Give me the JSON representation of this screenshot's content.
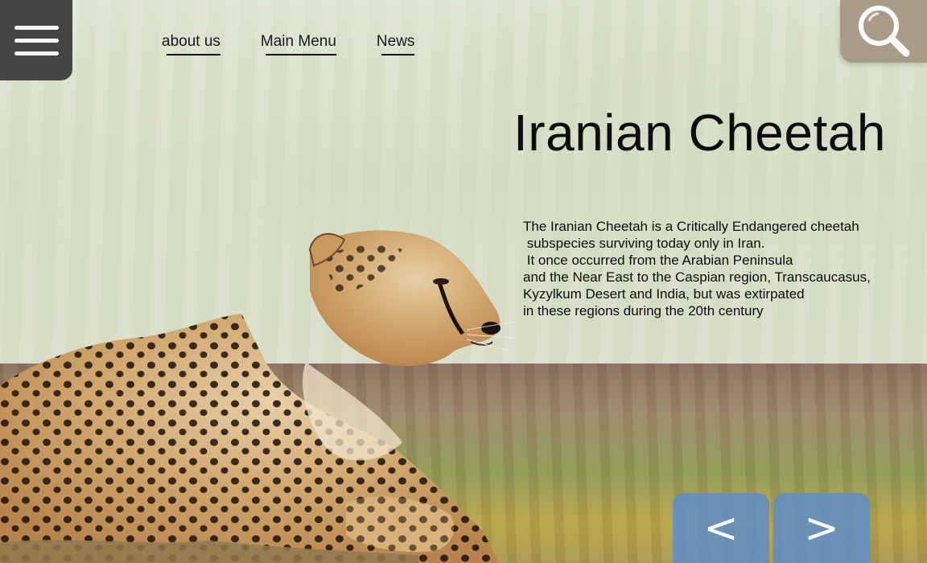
{
  "header": {
    "menu_icon": "hamburger-icon",
    "search_icon": "search-icon",
    "nav": [
      {
        "label": "about us"
      },
      {
        "label": "Main Menu"
      },
      {
        "label": "News"
      }
    ]
  },
  "hero": {
    "title": "Iranian Cheetah",
    "description_lines": [
      "The Iranian Cheetah is a Critically Endangered cheetah",
      " subspecies surviving today only in Iran.",
      " It once occurred from the Arabian Peninsula",
      "and the Near East to the Caspian region, Transcaucasus,",
      "Kyzylkum Desert and India, but was extirpated",
      "in these regions during the 20th century"
    ]
  },
  "carousel": {
    "prev_label": "<",
    "next_label": ">"
  },
  "colors": {
    "menu_bg": "#454545",
    "search_bg": "#a89c88",
    "arrow_bg": "#5a8ccd",
    "text": "#0d0d0d"
  }
}
